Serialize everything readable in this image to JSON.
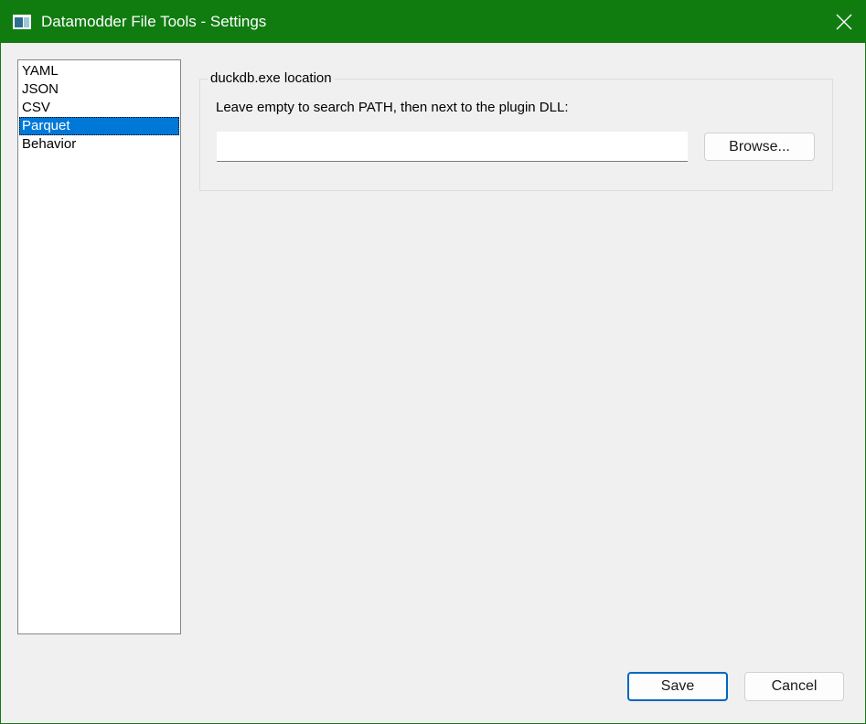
{
  "window": {
    "title": "Datamodder File Tools - Settings",
    "accent_color": "#107c10",
    "icon": "app-window-icon"
  },
  "sidebar": {
    "items": [
      {
        "label": "YAML",
        "selected": false
      },
      {
        "label": "JSON",
        "selected": false
      },
      {
        "label": "CSV",
        "selected": false
      },
      {
        "label": "Parquet",
        "selected": true
      },
      {
        "label": "Behavior",
        "selected": false
      }
    ],
    "selection_color": "#0078d7"
  },
  "parquet_settings": {
    "group_title": "duckdb.exe location",
    "description": "Leave empty to search PATH, then next to the plugin DLL:",
    "path_value": "",
    "browse_label": "Browse..."
  },
  "footer": {
    "save_label": "Save",
    "cancel_label": "Cancel"
  }
}
